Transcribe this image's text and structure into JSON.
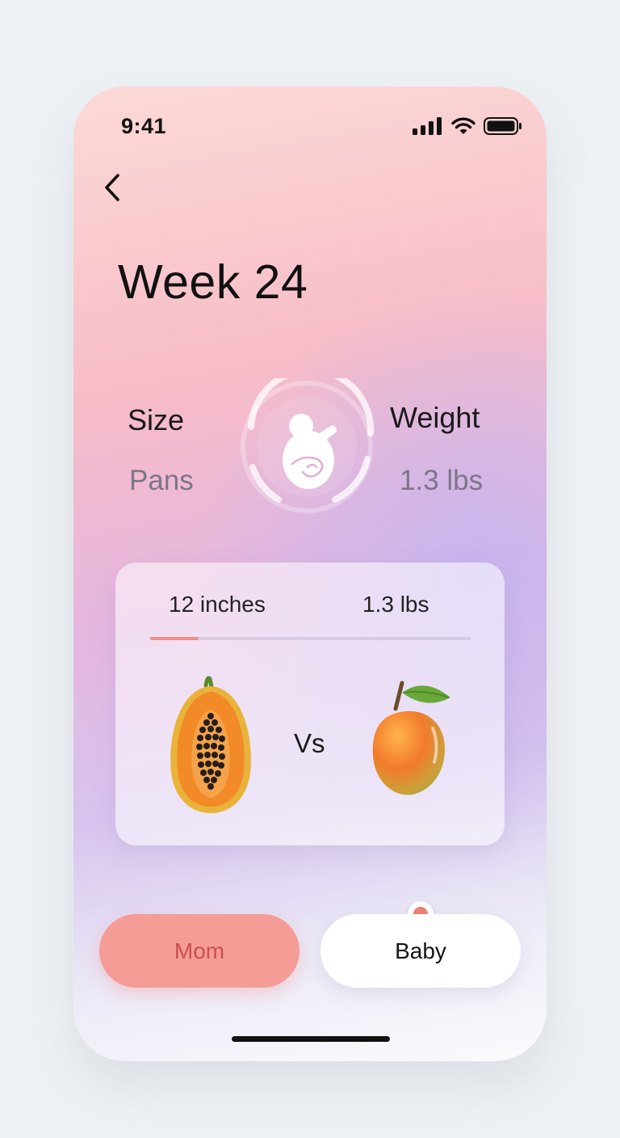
{
  "status_bar": {
    "time": "9:41"
  },
  "header": {
    "title": "Week 24"
  },
  "stats": {
    "size_label": "Size",
    "size_value": "Pans",
    "weight_label": "Weight",
    "weight_value": "1.3 lbs"
  },
  "comparison": {
    "length": "12 inches",
    "weight": "1.3 lbs",
    "progress_fraction": 0.15,
    "vs_label": "Vs",
    "left_icon": "papaya-icon",
    "right_icon": "mango-icon"
  },
  "tabs": {
    "mom_label": "Mom",
    "baby_label": "Baby",
    "selected": "Baby"
  },
  "colors": {
    "accent": "#f59c96",
    "accent_dark": "#c9504e",
    "dot": "#f07d74"
  }
}
